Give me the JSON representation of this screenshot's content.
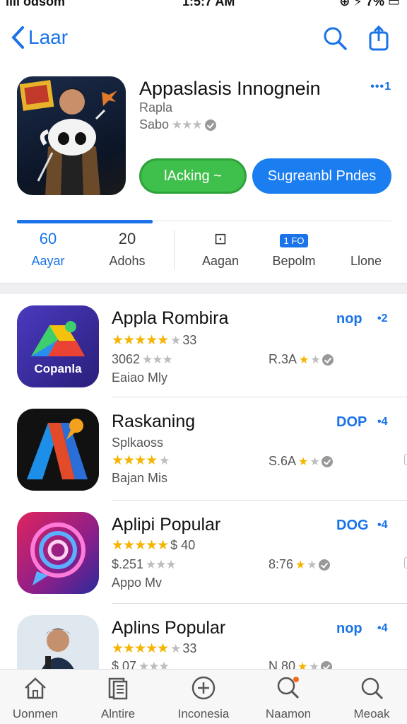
{
  "status": {
    "left": "ııll odsom",
    "time": "1:5:7 AM",
    "right": "⊕ ⚡ 7% ▭"
  },
  "nav": {
    "back_label": "Laar"
  },
  "hero": {
    "title": "Appaslasis Innognein",
    "subtitle": "Rapla",
    "rating_text": "Sabo",
    "more": "•••1",
    "primary_button": "lAcking ~",
    "secondary_button": "Sugreanbl Pndes"
  },
  "segments": [
    {
      "top": "60",
      "label": "Aayar"
    },
    {
      "top": "20",
      "label": "Adohs"
    },
    {
      "top": "⊡",
      "label": "Aagan"
    },
    {
      "top": "1 FO",
      "label": "Bepolm"
    },
    {
      "top": "",
      "label": "Llone"
    }
  ],
  "apps": [
    {
      "title": "Appla Rombira",
      "icon_text": "Copanla",
      "stars_text": "33",
      "line2": "3062",
      "line3": "Eaiao Mly",
      "right_rating": "R.3A",
      "get": "nop",
      "more": "•2"
    },
    {
      "title": "Raskaning",
      "subtitle": "Splkaoss",
      "line3": "Bajan Mis",
      "right_rating": "S.6A",
      "get": "DOP",
      "more": "•4"
    },
    {
      "title": "Aplipi Popular",
      "stars_text": "$ 40",
      "line2": "$.251",
      "line3": "Appo Mv",
      "right_rating": "8:76",
      "get": "DOG",
      "more": "•4"
    },
    {
      "title": "Aplins Popular",
      "stars_text": "33",
      "line2": "$.07",
      "right_rating": "N.80",
      "get": "nop",
      "more": "•4"
    }
  ],
  "tabs": [
    {
      "label": "Uonmen",
      "icon": "home-icon"
    },
    {
      "label": "Alntire",
      "icon": "book-icon"
    },
    {
      "label": "Inconesia",
      "icon": "add-circle-icon"
    },
    {
      "label": "Naamon",
      "icon": "search-icon"
    },
    {
      "label": "Meoak",
      "icon": "search-icon"
    }
  ],
  "colors": {
    "accent": "#1a73e8",
    "green": "#3fbf4b",
    "blue_button": "#1a7df0",
    "star": "#f5b400"
  }
}
